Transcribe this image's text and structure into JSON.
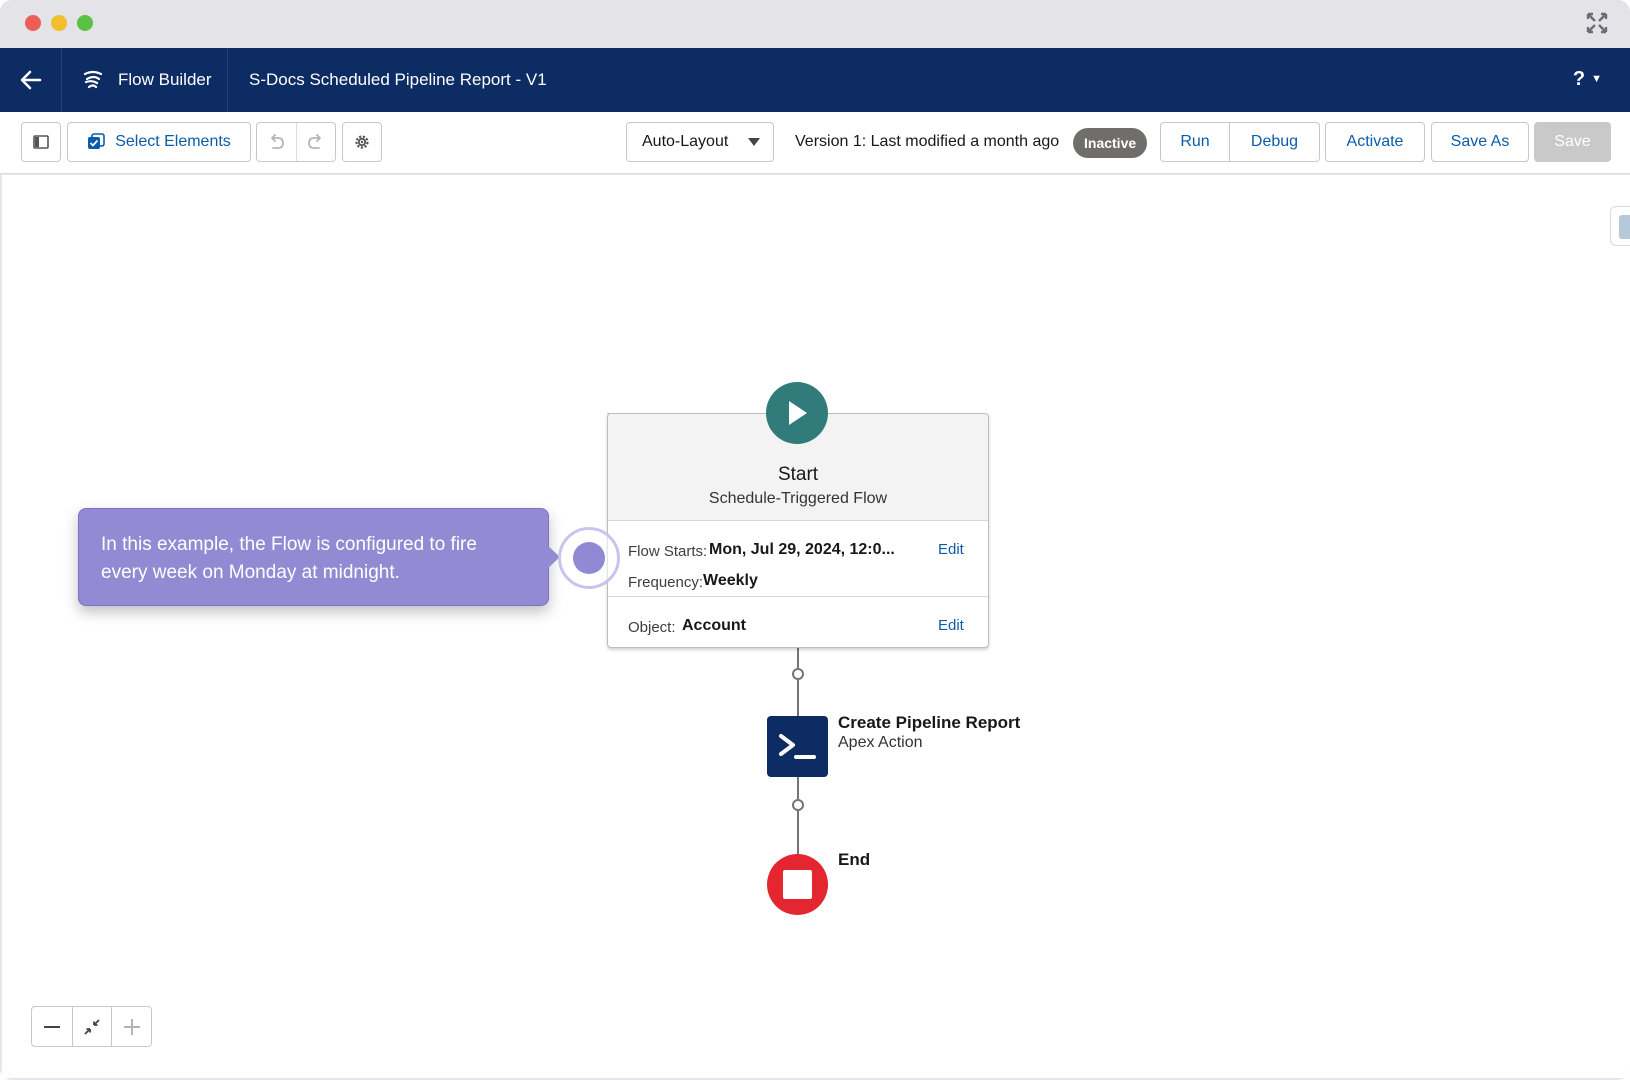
{
  "header": {
    "app_name": "Flow Builder",
    "flow_title": "S-Docs Scheduled Pipeline Report - V1",
    "help_label": "?"
  },
  "toolbar": {
    "select_elements_label": "Select Elements",
    "layout_value": "Auto-Layout",
    "version_text": "Version 1: Last modified a month ago",
    "status_badge": "Inactive",
    "run_label": "Run",
    "debug_label": "Debug",
    "activate_label": "Activate",
    "save_as_label": "Save As",
    "save_label": "Save"
  },
  "start_node": {
    "title": "Start",
    "subtitle": "Schedule-Triggered Flow",
    "flow_starts_label": "Flow Starts:",
    "flow_starts_value": "Mon, Jul 29, 2024, 12:0...",
    "frequency_label": "Frequency:",
    "frequency_value": "Weekly",
    "object_label": "Object:",
    "object_value": "Account",
    "edit_label": "Edit"
  },
  "action_node": {
    "title": "Create Pipeline Report",
    "subtitle": "Apex Action"
  },
  "end_node": {
    "label": "End"
  },
  "callout": {
    "text": "In this example, the Flow is configured to fire every week on Monday at midnight."
  },
  "colors": {
    "header_bg": "#0c2c63",
    "start_green": "#327b7b",
    "end_red": "#e3262f",
    "callout_purple": "#928ad3",
    "link_blue": "#0b5cab",
    "badge_gray": "#706e6b"
  },
  "icons": [
    "back-arrow-icon",
    "flow-builder-icon",
    "panel-toggle-icon",
    "select-checkbox-icon",
    "undo-icon",
    "redo-icon",
    "gear-icon",
    "chevron-down-icon",
    "play-icon",
    "apex-terminal-icon",
    "stop-icon",
    "zoom-out-icon",
    "fit-view-icon",
    "zoom-in-icon",
    "expand-window-icon"
  ]
}
